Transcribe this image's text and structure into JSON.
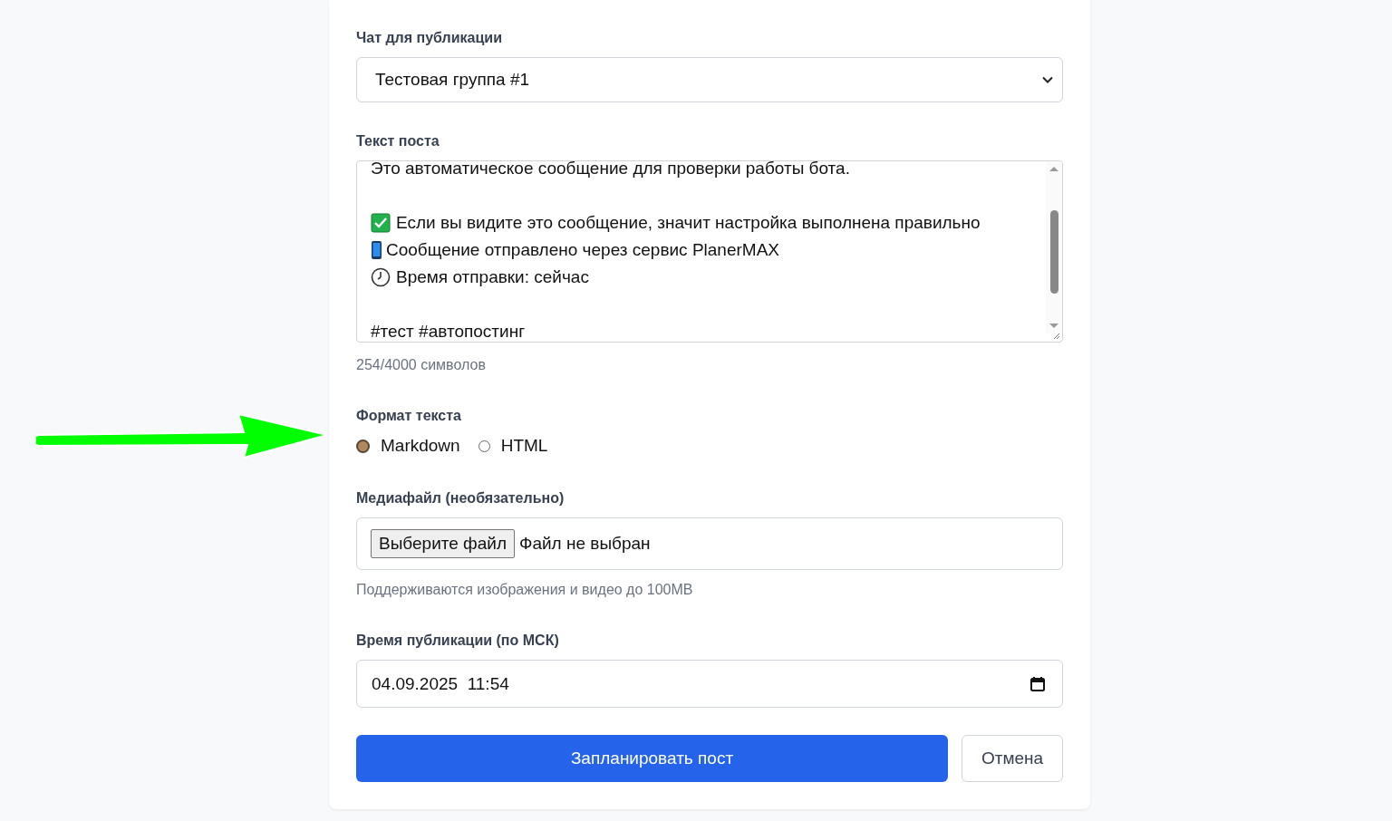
{
  "chat": {
    "label": "Чат для публикации",
    "value": "Тестовая группа #1"
  },
  "post": {
    "label": "Текст поста",
    "lines": [
      {
        "kind": "plain",
        "text": "Это автоматическое сообщение для проверки работы бота."
      },
      {
        "kind": "blank"
      },
      {
        "kind": "check",
        "text": "Если вы видите это сообщение, значит настройка выполнена правильно"
      },
      {
        "kind": "phone",
        "text": "Сообщение отправлено через сервис PlanerMAX"
      },
      {
        "kind": "clock",
        "text": "Время отправки: сейчас"
      },
      {
        "kind": "blank"
      },
      {
        "kind": "plain",
        "text": "#тест #автопостинг"
      }
    ],
    "counter": "254/4000 символов"
  },
  "format": {
    "label": "Формат текста",
    "options": [
      {
        "label": "Markdown",
        "selected": true
      },
      {
        "label": "HTML",
        "selected": false
      }
    ]
  },
  "media": {
    "label": "Медиафайл (необязательно)",
    "button": "Выберите файл",
    "status": "Файл не выбран",
    "help": "Поддерживаются изображения и видео до 100MB"
  },
  "time": {
    "label": "Время публикации (по МСК)",
    "value": "04.09.2025  11:54"
  },
  "buttons": {
    "submit": "Запланировать пост",
    "cancel": "Отмена"
  }
}
